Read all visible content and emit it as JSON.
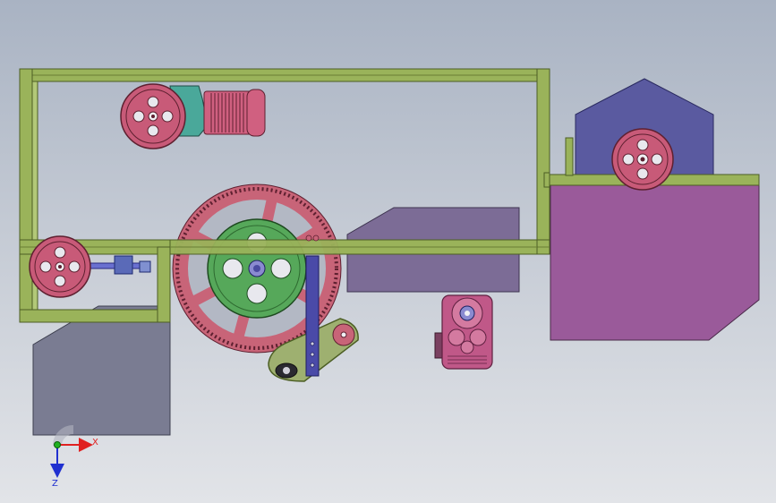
{
  "axes": {
    "x_label": "X",
    "z_label": "Z",
    "x_color": "#e02020",
    "y_color": "#20b020",
    "z_color": "#2030d0"
  },
  "colors": {
    "frame": "#9ab35a",
    "frame_edge": "#4c5e24",
    "pulley": "#c85a78",
    "big_gear": "#c86478",
    "green_wheel": "#56a85a",
    "motor_pink": "#d06080",
    "motor_teal": "#4aa89a",
    "hopper_purple": "#9a5a9a",
    "blue_housing": "#5a5aa0",
    "grey_block": "#7a7c92",
    "slate_block": "#7c6c96",
    "blue_arm": "#4a4aa8",
    "tensioner": "#9eb070",
    "gearbox": "#c05888"
  }
}
